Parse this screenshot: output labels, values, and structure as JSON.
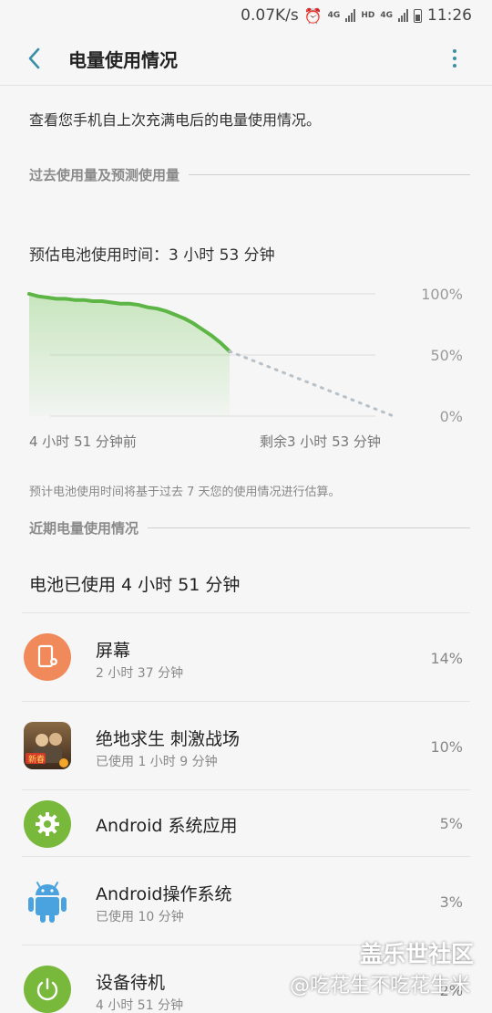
{
  "status": {
    "speed": "0.07K/s",
    "net1": "4G",
    "hd": "HD",
    "net2": "4G",
    "time": "11:26"
  },
  "header": {
    "title": "电量使用情况"
  },
  "intro": "查看您手机自上次充满电后的电量使用情况。",
  "sections": {
    "past": "过去使用量及预测使用量",
    "recent": "近期电量使用情况"
  },
  "estimate_text": "预估电池使用时间：3 小时 53 分钟",
  "chart_data": {
    "type": "line",
    "y_tick_labels": [
      "100%",
      "50%",
      "0%"
    ],
    "x_labels": [
      "4 小时 51 分钟前",
      "剩余3 小时 53 分钟"
    ],
    "ylim": [
      0,
      100
    ],
    "series": [
      {
        "kind": "actual",
        "color": "#5cb544",
        "x": [
          0,
          1,
          2,
          3,
          4,
          5,
          6,
          7,
          8,
          9,
          10,
          11,
          12,
          13,
          14,
          15,
          16,
          17,
          18,
          19,
          20,
          21,
          22
        ],
        "values": [
          100,
          98,
          97,
          96,
          96,
          95,
          95,
          94,
          94,
          93,
          92,
          92,
          91,
          89,
          88,
          86,
          83,
          80,
          76,
          71,
          66,
          60,
          53
        ]
      },
      {
        "kind": "predicted",
        "color": "#b8c0c8",
        "x": [
          22,
          40
        ],
        "values": [
          53,
          0
        ]
      }
    ],
    "x_max": 40
  },
  "note": "预计电池使用时间将基于过去 7 天您的使用情况进行估算。",
  "battery_used": "电池已使用 4 小时 51 分钟",
  "apps": [
    {
      "name": "屏幕",
      "sub": "2 小时 37 分钟",
      "pct": "14%",
      "icon": "screen-icon",
      "color": "#f08a5a"
    },
    {
      "name": "绝地求生 刺激战场",
      "sub": "已使用 1 小时 9 分钟",
      "pct": "10%",
      "icon": "pubg-game-icon",
      "color": "#7b5a3a",
      "badge": "新春"
    },
    {
      "name": "Android 系统应用",
      "sub": "",
      "pct": "5%",
      "icon": "gear-icon",
      "color": "#78b83a"
    },
    {
      "name": "Android操作系统",
      "sub": "已使用 10 分钟",
      "pct": "3%",
      "icon": "android-icon",
      "color": "#4aa3df"
    },
    {
      "name": "设备待机",
      "sub": "4 小时 51 分钟",
      "pct": "2%",
      "icon": "power-icon",
      "color": "#78b83a"
    }
  ],
  "watermark": {
    "line1": "盖乐世社区",
    "line2": "@吃花生不吃花生米"
  }
}
